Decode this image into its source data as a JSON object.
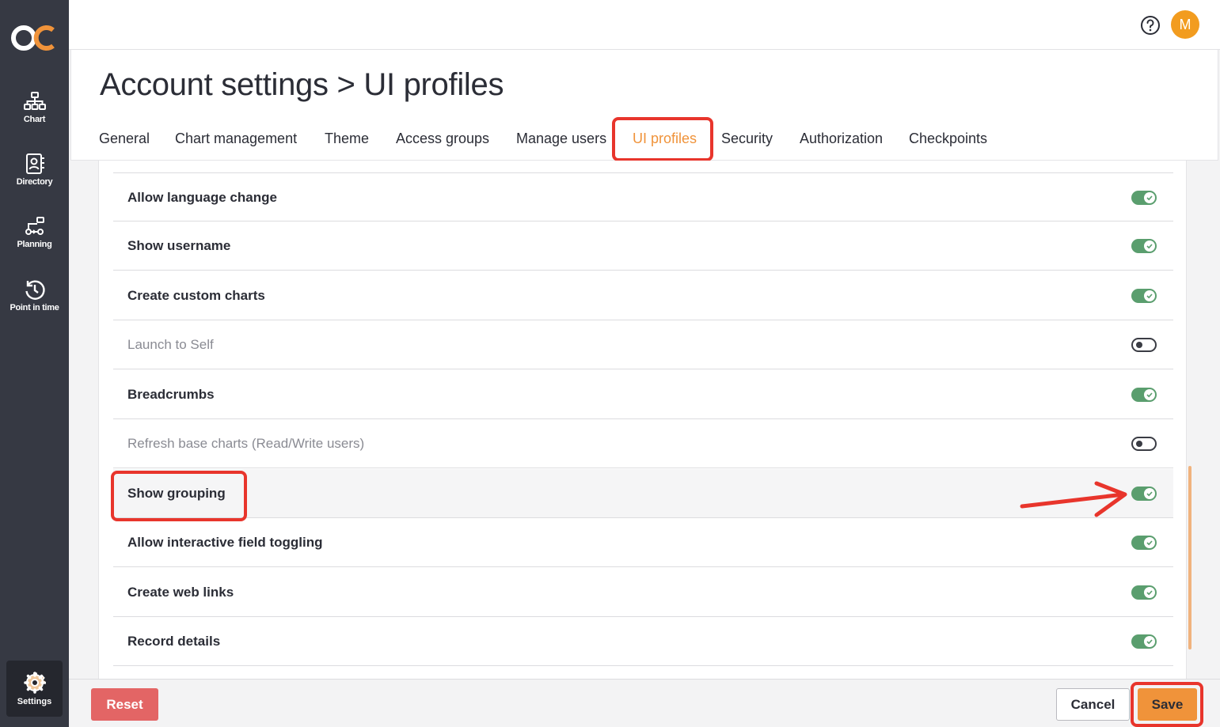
{
  "sidebar": {
    "logo_text": "OC",
    "items": [
      {
        "label": "Chart",
        "icon": "org-chart-icon"
      },
      {
        "label": "Directory",
        "icon": "directory-icon"
      },
      {
        "label": "Planning",
        "icon": "planning-icon"
      },
      {
        "label": "Point in time",
        "icon": "history-icon"
      }
    ],
    "settings": {
      "label": "Settings",
      "icon": "gear-icon"
    }
  },
  "topbar": {
    "help_icon": "help-icon",
    "avatar_initial": "M",
    "avatar_color": "#f29c1f"
  },
  "page": {
    "title": "Account settings > UI profiles"
  },
  "tabs": [
    {
      "label": "General"
    },
    {
      "label": "Chart management"
    },
    {
      "label": "Theme"
    },
    {
      "label": "Access groups"
    },
    {
      "label": "Manage users"
    },
    {
      "label": "UI profiles",
      "active": true
    },
    {
      "label": "Security"
    },
    {
      "label": "Authorization"
    },
    {
      "label": "Checkpoints"
    }
  ],
  "settings_list": [
    {
      "label": "Allow language change",
      "enabled": true
    },
    {
      "label": "Show username",
      "enabled": true
    },
    {
      "label": "Create custom charts",
      "enabled": true
    },
    {
      "label": "Launch to Self",
      "enabled": false
    },
    {
      "label": "Breadcrumbs",
      "enabled": true
    },
    {
      "label": "Refresh base charts (Read/Write users)",
      "enabled": false
    },
    {
      "label": "Show grouping",
      "enabled": true,
      "highlighted": true
    },
    {
      "label": "Allow interactive field toggling",
      "enabled": true
    },
    {
      "label": "Create web links",
      "enabled": true
    },
    {
      "label": "Record details",
      "enabled": true
    }
  ],
  "footer": {
    "reset_label": "Reset",
    "cancel_label": "Cancel",
    "save_label": "Save"
  },
  "colors": {
    "accent": "#f0933a",
    "toggle_on": "#5a9e6e",
    "highlight": "#e8352c",
    "sidebar": "#363943",
    "reset": "#e36565"
  }
}
